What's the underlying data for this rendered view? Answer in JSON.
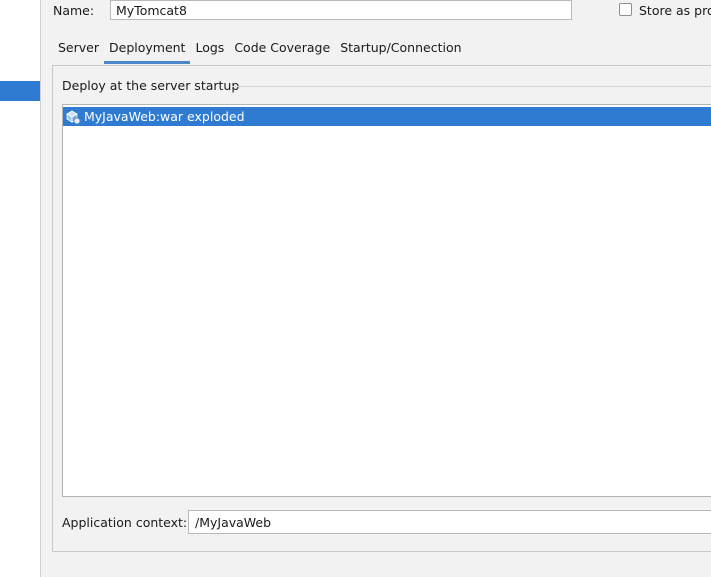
{
  "name_field": {
    "label": "Name:",
    "value": "MyTomcat8"
  },
  "store_option": {
    "label": "Store as pro"
  },
  "tabs": [
    {
      "label": "Server",
      "active": false
    },
    {
      "label": "Deployment",
      "active": true
    },
    {
      "label": "Logs",
      "active": false
    },
    {
      "label": "Code Coverage",
      "active": false
    },
    {
      "label": "Startup/Connection",
      "active": false
    }
  ],
  "deployment": {
    "group_title": "Deploy at the server startup",
    "items": [
      {
        "label": "MyJavaWeb:war exploded",
        "icon": "artifact-exploded-icon",
        "selected": true
      }
    ]
  },
  "app_context": {
    "label": "Application context:",
    "value": "/MyJavaWeb"
  },
  "colors": {
    "selection": "#2f7bd1",
    "tab_underline": "#4a86c8",
    "panel_bg": "#f2f2f2"
  }
}
